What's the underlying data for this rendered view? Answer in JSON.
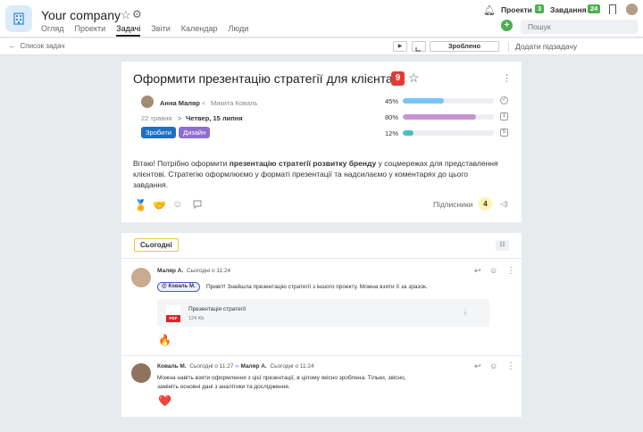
{
  "app": {
    "company": "Your company",
    "nav": [
      "Огляд",
      "Проекти",
      "Задачі",
      "Звіти",
      "Календар",
      "Люди"
    ],
    "active_nav": 2
  },
  "topright": {
    "projects_label": "Проекти",
    "projects_count": "3",
    "tasks_label": "Завдання",
    "tasks_count": "24",
    "search_placeholder": "Пошук",
    "add_label": "+"
  },
  "subbar": {
    "back_label": "Список задач",
    "play_label": "▶",
    "done_label": "Зроблено",
    "add_subtask": "Додати підзадачу"
  },
  "task": {
    "title": "Оформити презентацію стратегії для клієнта",
    "number": "9",
    "assignee": "Анна Маляр",
    "arrow": "<",
    "owner": "Микита Коваль",
    "date_start": "22 травня",
    "date_arrow": ">",
    "date_end": "Четвер, 15 липня",
    "tags": [
      {
        "label": "Зробити",
        "color": "#1e6fc6"
      },
      {
        "label": "Дизайн",
        "color": "#8e6fd0"
      }
    ],
    "progress": [
      {
        "label": "45%",
        "value": 45,
        "color": "#78c3f5",
        "icon": "✓"
      },
      {
        "label": "80%",
        "value": 80,
        "color": "#c793d5",
        "icon": "1"
      },
      {
        "label": "12%",
        "value": 12,
        "color": "#4dbfc3",
        "icon": "5"
      }
    ],
    "desc_prefix": "Вітаю! Потрібно оформити ",
    "desc_bold": "презентацію стратегії розвитку бренду",
    "desc_suffix": " у соцмережах для представлення клієнтові. Стратегію оформлюємо у форматі презентації та надсилаємо у коментарях до цього завдання.",
    "subscribers_label": "Підписники",
    "subscribers_count": "4"
  },
  "comments": {
    "tab_label": "Сьогодні",
    "items": [
      {
        "author": "Маляр А.",
        "time": "Сьогодні о 11:24",
        "mention": "Коваль М.",
        "text": "Привіт! Знайшла презентацію стратегії з іншого проекту. Можна взяти її за зразок.",
        "attachment": {
          "name": "Презентація стратегії",
          "size": "124 Kb",
          "type": "PDF"
        },
        "reaction": "🔥"
      },
      {
        "author": "Коваль М.",
        "time": "Сьогодні о 11:27",
        "reply_to": "Маляр А.",
        "reply_time": "Сьогодні о 11:24",
        "text_line1": "Можна навіть взяти оформлення з цієї презентації, в цілому якісно зроблена. Тільки, звісно,",
        "text_line2": "замініть основні дані з аналітики та дослідження.",
        "reaction": "❤️"
      }
    ]
  }
}
